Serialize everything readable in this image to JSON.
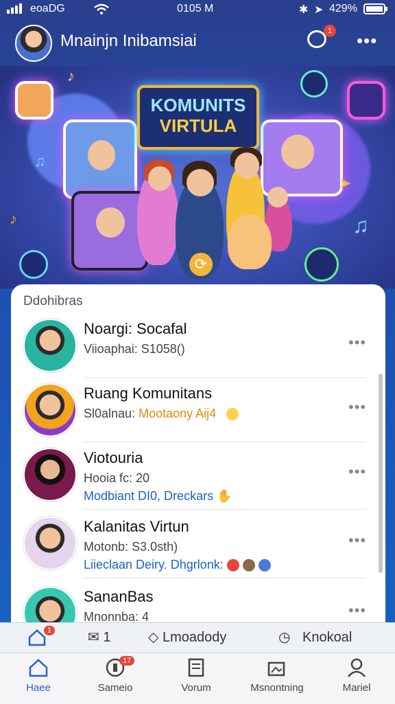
{
  "status": {
    "carrier": "eoaDG",
    "time": "0105 M",
    "battery": "429%"
  },
  "header": {
    "title": "Mnainjn Inibamsiai",
    "chat_badge": "1"
  },
  "banner": {
    "line1": "KOMUNITS",
    "line2": "VIRTULA"
  },
  "panel": {
    "title": "Ddohibras",
    "rows": [
      {
        "name": "Noargi: Socafal",
        "line2": "Viioaphai: S1058()",
        "line3": ""
      },
      {
        "name": "Ruang Komunitans",
        "line2": "Sl0alnau:",
        "line2_accent": "Mootaony Aij4",
        "line3": ""
      },
      {
        "name": "Viotouria",
        "line2": "Hooia fc: 20",
        "line3": "Modbiant DI0, Dreckars"
      },
      {
        "name": "Kalanitas Virtun",
        "line2": "Motonb: S3.0sth)",
        "line3": "Liieclaan Deiry. Dhgrlonk:"
      },
      {
        "name": "SananBas",
        "line2": "Mnonnba: 4",
        "line3": ""
      }
    ]
  },
  "subtabs": {
    "t1_badge": "1",
    "t2": "1",
    "t3": "Lmoadody",
    "t4": "Knokoal"
  },
  "nav": [
    {
      "label": "Haee"
    },
    {
      "label": "Sameio",
      "badge": "17"
    },
    {
      "label": "Vorum"
    },
    {
      "label": "Msnontning"
    },
    {
      "label": "Mariel"
    }
  ],
  "colors": {
    "accent": "#2a5fd0",
    "orange_text": "#e08a12",
    "blue_text": "#1a62c8",
    "green_text": "#1c8c3a",
    "badge": "#e8453a"
  }
}
